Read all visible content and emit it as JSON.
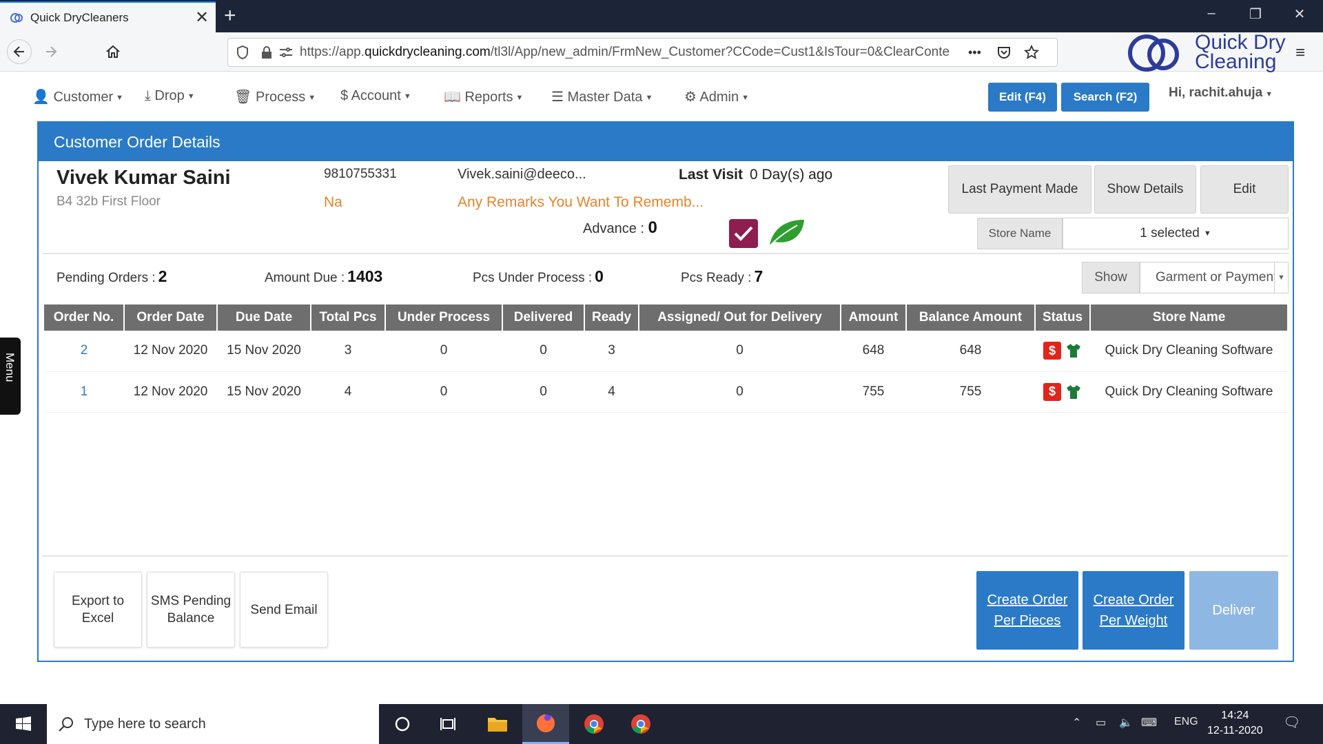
{
  "browser": {
    "tab_title": "Quick DryCleaners",
    "tab_close": "✕",
    "new_tab": "+",
    "url_prefix": "https://app.",
    "url_domain": "quickdrycleaning.com",
    "url_rest": "/tl3l/App/new_admin/FrmNew_Customer?CCode=Cust1&IsTour=0&ClearConte",
    "more_dots": "•••",
    "window_controls": [
      "–",
      "❐",
      "✕"
    ]
  },
  "brand": {
    "line1": "Quick Dry",
    "line2": "Cleaning",
    "color": "#2d3c9b"
  },
  "menu": {
    "items": [
      {
        "icon": "user-icon",
        "label": "Customer"
      },
      {
        "icon": "download-icon",
        "label": "Drop"
      },
      {
        "icon": "trash-icon",
        "label": "Process"
      },
      {
        "icon": "dollar-icon",
        "label": "Account"
      },
      {
        "icon": "book-icon",
        "label": "Reports"
      },
      {
        "icon": "database-icon",
        "label": "Master Data"
      },
      {
        "icon": "gear-icon",
        "label": "Admin"
      }
    ],
    "edit_button": "Edit (F4)",
    "search_button": "Search (F2)",
    "greeting": "Hi,  rachit.ahuja"
  },
  "panel": {
    "title": "Customer Order Details",
    "customer": {
      "name": "Vivek Kumar Saini",
      "address": "B4 32b First Floor",
      "phone": "9810755331",
      "na": "Na",
      "email": "Vivek.saini@deeco...",
      "remarks": "Any Remarks You Want To Rememb...",
      "last_visit_label": "Last Visit",
      "last_visit_value": "0 Day(s) ago",
      "advance_label": "Advance :",
      "advance_value": "0"
    },
    "buttons": {
      "last_payment": "Last Payment Made",
      "show_details": "Show Details",
      "edit": "Edit"
    },
    "store_label": "Store Name",
    "store_value": "1 selected",
    "stats": {
      "pending_orders_label": "Pending Orders :",
      "pending_orders_value": "2",
      "amount_due_label": "Amount Due :",
      "amount_due_value": "1403",
      "pcs_under_process_label": "Pcs Under Process :",
      "pcs_under_process_value": "0",
      "pcs_ready_label": "Pcs Ready :",
      "pcs_ready_value": "7"
    },
    "show_label": "Show",
    "show_value": "Garment or Payment",
    "table": {
      "headers": [
        "Order No.",
        "Order Date",
        "Due Date",
        "Total Pcs",
        "Under Process",
        "Delivered",
        "Ready",
        "Assigned/ Out for Delivery",
        "Amount",
        "Balance Amount",
        "Status",
        "Store Name"
      ],
      "rows": [
        {
          "order_no": "2",
          "order_date": "12 Nov 2020",
          "due_date": "15 Nov 2020",
          "total_pcs": "3",
          "under_process": "0",
          "delivered": "0",
          "ready": "3",
          "assigned": "0",
          "amount": "648",
          "balance": "648",
          "store": "Quick Dry Cleaning Software"
        },
        {
          "order_no": "1",
          "order_date": "12 Nov 2020",
          "due_date": "15 Nov 2020",
          "total_pcs": "4",
          "under_process": "0",
          "delivered": "0",
          "ready": "4",
          "assigned": "0",
          "amount": "755",
          "balance": "755",
          "store": "Quick Dry Cleaning Software"
        }
      ]
    },
    "actions": {
      "export_excel": "Export to Excel",
      "sms_pending": "SMS Pending Balance",
      "send_email": "Send Email",
      "create_pieces": "Create Order Per Pieces",
      "create_weight": "Create Order Per Weight",
      "deliver": "Deliver"
    },
    "side_menu": "Menu"
  },
  "colors": {
    "accent": "#2a7ac7",
    "orange": "#e8832a",
    "table_header": "#6e6e6e",
    "check": "#8e1e4f",
    "leaf": "#2e9e2e",
    "status_red": "#e0251b",
    "status_green": "#1e7a3a"
  },
  "taskbar": {
    "search_placeholder": "Type here to search",
    "lang": "ENG",
    "time": "14:24",
    "date": "12-11-2020"
  }
}
